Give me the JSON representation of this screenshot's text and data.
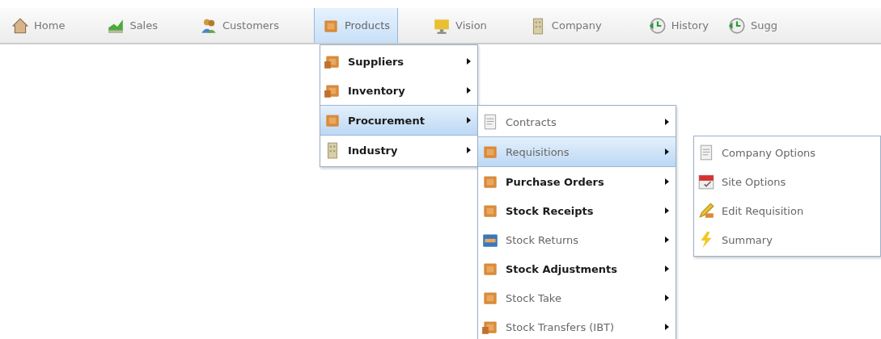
{
  "nav": {
    "left_items": [
      {
        "label": "Home",
        "selected": false
      },
      {
        "label": "Sales",
        "selected": false
      },
      {
        "label": "Customers",
        "selected": false
      },
      {
        "label": "Products",
        "selected": true
      },
      {
        "label": "Vision",
        "selected": false
      },
      {
        "label": "Company",
        "selected": false
      }
    ],
    "right_items": [
      {
        "label": "History",
        "selected": false
      },
      {
        "label": "Sugg",
        "selected": false
      }
    ]
  },
  "menus": [
    {
      "items": [
        {
          "label": "Suppliers",
          "bold": true,
          "submenu": true,
          "selected": false
        },
        {
          "label": "Inventory",
          "bold": true,
          "submenu": true,
          "selected": false
        },
        {
          "label": "Procurement",
          "bold": true,
          "submenu": true,
          "selected": true
        },
        {
          "label": "Industry",
          "bold": true,
          "submenu": true,
          "selected": false
        }
      ]
    },
    {
      "items": [
        {
          "label": "Contracts",
          "bold": false,
          "submenu": true,
          "selected": false
        },
        {
          "label": "Requisitions",
          "bold": false,
          "submenu": true,
          "selected": true
        },
        {
          "label": "Purchase Orders",
          "bold": true,
          "submenu": true,
          "selected": false
        },
        {
          "label": "Stock Receipts",
          "bold": true,
          "submenu": true,
          "selected": false
        },
        {
          "label": "Stock Returns",
          "bold": false,
          "submenu": true,
          "selected": false
        },
        {
          "label": "Stock Adjustments",
          "bold": true,
          "submenu": true,
          "selected": false
        },
        {
          "label": "Stock Take",
          "bold": false,
          "submenu": true,
          "selected": false
        },
        {
          "label": "Stock Transfers (IBT)",
          "bold": false,
          "submenu": true,
          "selected": false
        }
      ]
    },
    {
      "items": [
        {
          "label": "Company Options",
          "bold": false,
          "submenu": false,
          "selected": false
        },
        {
          "label": "Site Options",
          "bold": false,
          "submenu": false,
          "selected": false
        },
        {
          "label": "Edit Requisition",
          "bold": false,
          "submenu": false,
          "selected": false
        },
        {
          "label": "Summary",
          "bold": false,
          "submenu": false,
          "selected": false
        }
      ]
    }
  ]
}
